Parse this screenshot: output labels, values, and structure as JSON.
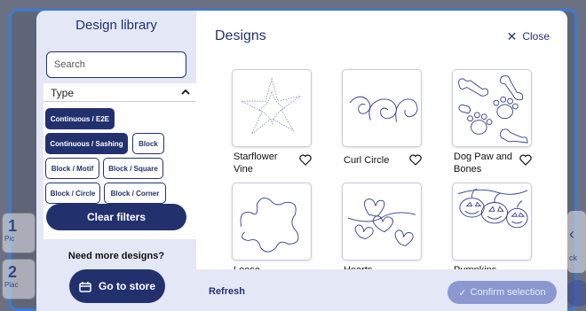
{
  "background": {
    "tiles": [
      {
        "num": "1",
        "label": "Pic"
      },
      {
        "num": "2",
        "label": "Plac"
      }
    ],
    "right_label": "ck"
  },
  "library": {
    "title": "Design library",
    "search_placeholder": "Search",
    "type_label": "Type",
    "filters": [
      {
        "label": "Continuous / E2E",
        "selected": true
      },
      {
        "label": "Continuous / Sashing",
        "selected": true
      },
      {
        "label": "Block",
        "selected": false
      },
      {
        "label": "Block / Motif",
        "selected": false
      },
      {
        "label": "Block / Square",
        "selected": false
      },
      {
        "label": "Block / Circle",
        "selected": false
      },
      {
        "label": "Block / Corner",
        "selected": false
      }
    ],
    "clear_label": "Clear filters",
    "need_more": "Need more designs?",
    "store_label": "Go to store"
  },
  "designs": {
    "title": "Designs",
    "close_label": "Close",
    "items": [
      {
        "name": "Starflower Vine",
        "icon": "starflower-thumbnail"
      },
      {
        "name": "Curl Circle",
        "icon": "curl-circle-thumbnail"
      },
      {
        "name": "Dog Paw and Bones",
        "icon": "dog-paw-thumbnail"
      },
      {
        "name": "Loose",
        "icon": "loose-thumbnail"
      },
      {
        "name": "Hearts",
        "icon": "hearts-thumbnail"
      },
      {
        "name": "Pumpkins",
        "icon": "pumpkins-thumbnail"
      }
    ],
    "refresh_label": "Refresh",
    "confirm_label": "Confirm selection"
  },
  "colors": {
    "primary": "#22316e",
    "panel": "#e4e7f6",
    "confirm_disabled": "#8a98cf"
  }
}
